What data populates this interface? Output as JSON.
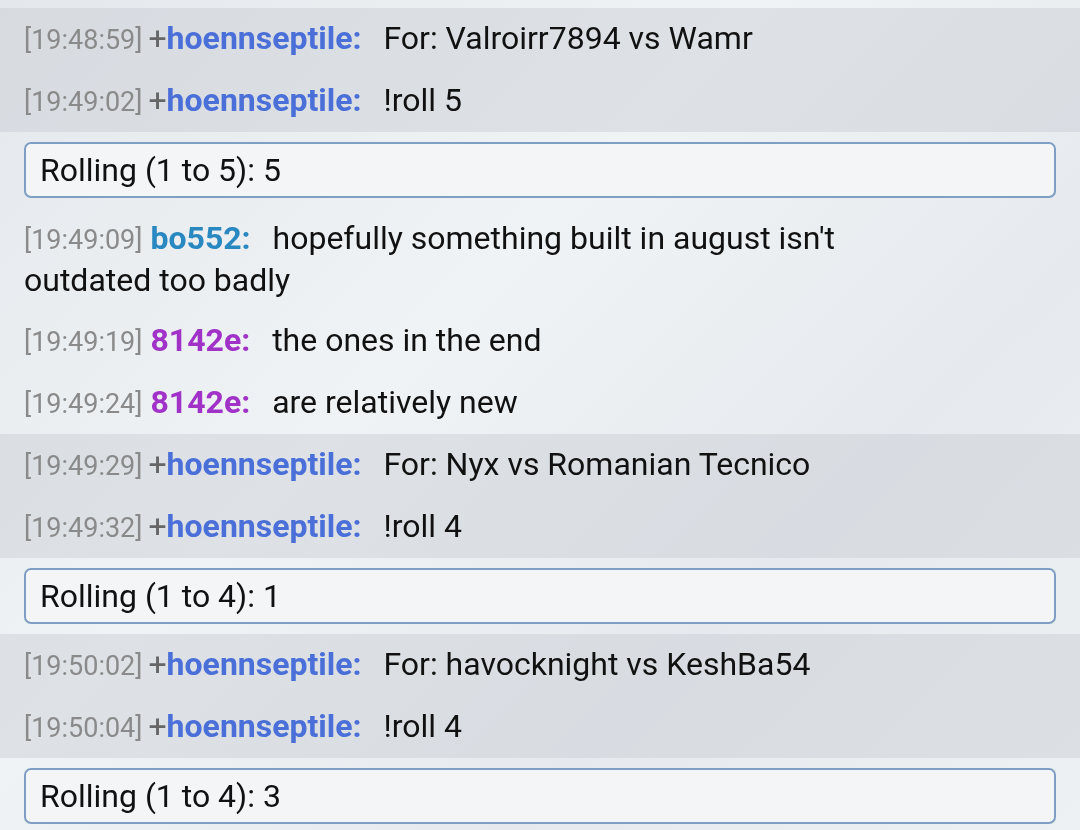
{
  "messages": [
    {
      "kind": "chat",
      "time": "[19:48:59]",
      "rank": "+",
      "user": "hoennseptile:",
      "color": "#4a6fd8",
      "text": "For: Valroirr7894 vs Wamr",
      "highlighted": true
    },
    {
      "kind": "chat",
      "time": "[19:49:02]",
      "rank": "+",
      "user": "hoennseptile:",
      "color": "#4a6fd8",
      "text": "!roll 5",
      "highlighted": true
    },
    {
      "kind": "roll",
      "text": "Rolling (1 to 5): 5"
    },
    {
      "kind": "chat",
      "time": "[19:49:09]",
      "user": "bo552:",
      "color": "#2a88c0",
      "text": "hopefully something built in august isn't outdated too badly",
      "highlighted": false
    },
    {
      "kind": "chat",
      "time": "[19:49:19]",
      "user": "8142e:",
      "color": "#a032c8",
      "text": "the ones in the end",
      "highlighted": false
    },
    {
      "kind": "chat",
      "time": "[19:49:24]",
      "user": "8142e:",
      "color": "#a032c8",
      "text": "are relatively new",
      "highlighted": false
    },
    {
      "kind": "chat",
      "time": "[19:49:29]",
      "rank": "+",
      "user": "hoennseptile:",
      "color": "#4a6fd8",
      "text": "For: Nyx vs Romanian Tecnico",
      "highlighted": true
    },
    {
      "kind": "chat",
      "time": "[19:49:32]",
      "rank": "+",
      "user": "hoennseptile:",
      "color": "#4a6fd8",
      "text": "!roll 4",
      "highlighted": true
    },
    {
      "kind": "roll",
      "text": "Rolling (1 to 4): 1"
    },
    {
      "kind": "chat",
      "time": "[19:50:02]",
      "rank": "+",
      "user": "hoennseptile:",
      "color": "#4a6fd8",
      "text": "For: havocknight vs KeshBa54",
      "highlighted": true
    },
    {
      "kind": "chat",
      "time": "[19:50:04]",
      "rank": "+",
      "user": "hoennseptile:",
      "color": "#4a6fd8",
      "text": "!roll 4",
      "highlighted": true
    },
    {
      "kind": "roll",
      "text": "Rolling (1 to 4): 3"
    }
  ]
}
